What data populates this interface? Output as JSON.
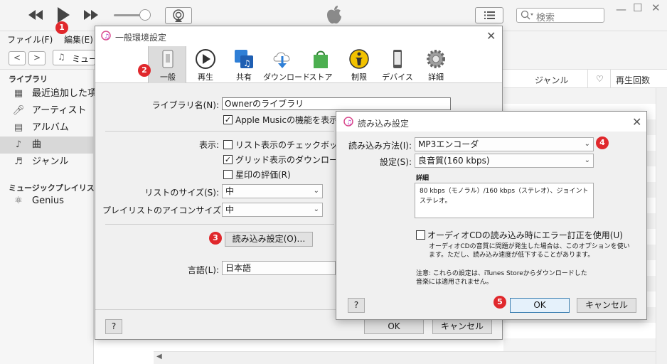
{
  "toolbar": {
    "search_placeholder": "検索",
    "icons": [
      "rewind-icon",
      "play-icon",
      "fast-forward-icon",
      "airplay-icon",
      "apple-logo-icon",
      "list-view-icon",
      "search-icon"
    ]
  },
  "menu": {
    "file": "ファイル(F)",
    "edit": "編集(E)"
  },
  "nav": {
    "back": "<",
    "forward": ">",
    "media_label": "ミュー"
  },
  "sidebar": {
    "library_header": "ライブラリ",
    "items": [
      {
        "label": "最近追加した項",
        "icon": "grid-icon"
      },
      {
        "label": "アーティスト",
        "icon": "microphone-icon"
      },
      {
        "label": "アルバム",
        "icon": "album-icon"
      },
      {
        "label": "曲",
        "icon": "music-note-icon",
        "selected": true
      },
      {
        "label": "ジャンル",
        "icon": "guitar-icon"
      }
    ],
    "playlists_header": "ミュージックプレイリスト ⌄",
    "playlists": [
      {
        "label": "Genius",
        "icon": "genius-atom-icon"
      }
    ]
  },
  "songlist": {
    "col_genre": "ジャンル",
    "col_heart": "♡",
    "col_plays": "再生回数"
  },
  "general_dialog": {
    "title": "一般環境設定",
    "tabs": [
      {
        "label": "一般",
        "selected": true
      },
      {
        "label": "再生"
      },
      {
        "label": "共有"
      },
      {
        "label": "ダウンロード"
      },
      {
        "label": "ストア"
      },
      {
        "label": "制限"
      },
      {
        "label": "デバイス"
      },
      {
        "label": "詳細"
      }
    ],
    "library_name_label": "ライブラリ名(N):",
    "library_name_value": "Ownerのライブラリ",
    "apple_music_check": "Apple Musicの機能を表示(A",
    "display_label": "表示:",
    "list_checkbox": "リスト表示のチェックボックス(K",
    "grid_download": "グリッド表示のダウンロードバッジ",
    "star_rating": "星印の評価(R)",
    "list_size_label": "リストのサイズ(S):",
    "list_size_value": "中",
    "playlist_icon_label": "プレイリストのアイコンサイズ(P):",
    "playlist_icon_value": "中",
    "import_button": "読み込み設定(O)…",
    "language_label": "言語(L):",
    "language_value": "日本語",
    "help": "?",
    "ok": "OK",
    "cancel": "キャンセル"
  },
  "import_dialog": {
    "title": "読み込み設定",
    "method_label": "読み込み方法(I):",
    "method_value": "MP3エンコーダ",
    "setting_label": "設定(S):",
    "setting_value": "良音質(160 kbps)",
    "detail_label": "詳細",
    "detail_text_1": "80 kbps（モノラル）/160 kbps（ステレオ）、ジョイント",
    "detail_text_2": "ステレオ。",
    "error_correction": "オーディオCDの読み込み時にエラー訂正を使用(U)",
    "error_note_1": "オーディオCDの音質に問題が発生した場合は、このオプションを使い",
    "error_note_2": "ます。ただし、読み込み速度が低下することがあります。",
    "note_1": "注意: これらの設定は、iTunes Storeからダウンロードした",
    "note_2": "音楽には適用されません。",
    "help": "?",
    "ok": "OK",
    "cancel": "キャンセル"
  },
  "badges": [
    "1",
    "2",
    "3",
    "4",
    "5"
  ],
  "colors": {
    "badge": "#e0282c",
    "accent": "#3c7fb1"
  }
}
